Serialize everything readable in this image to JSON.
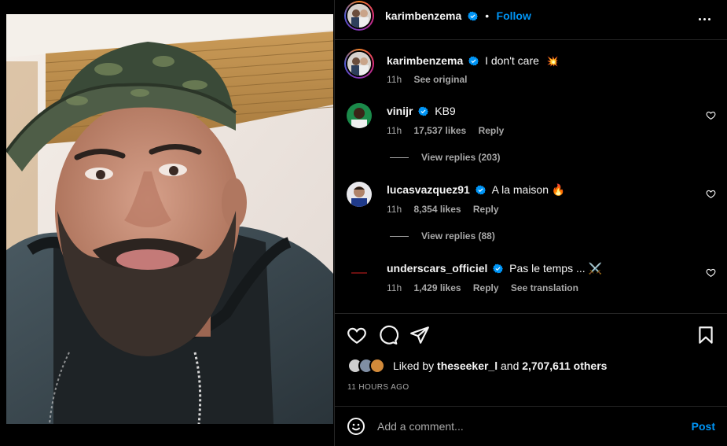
{
  "post": {
    "author": "karimbenzema",
    "follow_label": "Follow",
    "separator": "•",
    "caption_text": "I don't care",
    "caption_emoji": "💥",
    "caption_time": "11h",
    "see_original": "See original"
  },
  "comments": [
    {
      "user": "vinijr",
      "text": "KB9",
      "time": "11h",
      "likes": "17,537 likes",
      "reply": "Reply",
      "view_replies": "View replies (203)"
    },
    {
      "user": "lucasvazquez91",
      "text": "A la maison 🔥",
      "time": "11h",
      "likes": "8,354 likes",
      "reply": "Reply",
      "view_replies": "View replies (88)"
    },
    {
      "user": "underscars_officiel",
      "text": "Pas le temps ... ⚔️",
      "time": "11h",
      "likes": "1,429 likes",
      "reply": "Reply",
      "translation": "See translation"
    }
  ],
  "liked_by": {
    "prefix": "Liked by",
    "user": "theseeker_l",
    "and": "and",
    "others": "2,707,611 others"
  },
  "time_ago": "11 HOURS AGO",
  "comment_box": {
    "placeholder": "Add a comment...",
    "post_label": "Post"
  },
  "icons": {
    "verified": "verified-badge-icon",
    "more": "more-options-icon",
    "like": "heart-icon",
    "comment": "comment-bubble-icon",
    "share": "paper-plane-icon",
    "save": "bookmark-icon",
    "emoji": "emoji-smile-icon"
  },
  "colors": {
    "accent": "#0095f6",
    "background": "#000000",
    "text": "#f5f5f5",
    "muted": "#a8a8a8",
    "border": "#262626"
  }
}
